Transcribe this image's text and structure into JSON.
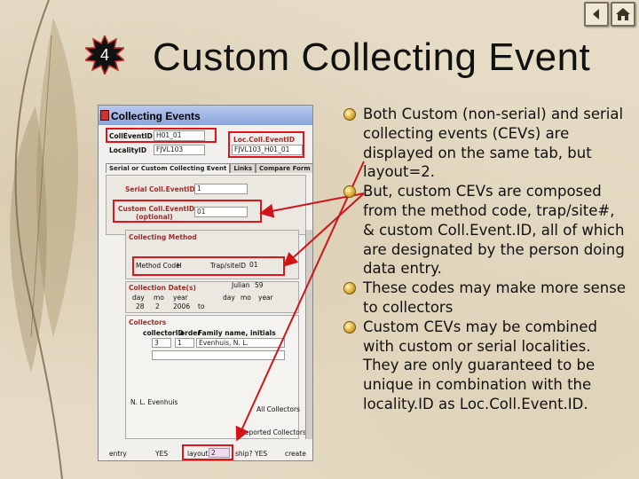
{
  "slide": {
    "number": "4",
    "title": "Custom Collecting Event"
  },
  "nav": {
    "back_icon": "back-arrow-icon",
    "home_icon": "home-icon"
  },
  "screenshot": {
    "header_title": "Collecting Events",
    "coll_event_id_label": "CollEventID",
    "coll_event_id_value": "H01_01",
    "locality_id_label": "LocalityID",
    "locality_id_value": "FJVL103",
    "loc_coll_event_id_label": "Loc.Coll.EventID",
    "loc_coll_event_id_value": "FJVL103_H01_01",
    "tabs": [
      "Serial or Custom Collecting Event",
      "Links",
      "Compare Form"
    ],
    "serial_label": "Serial Coll.EventID",
    "serial_value": "1",
    "custom_label_1": "Custom Coll.EventID",
    "custom_label_2": "(optional)",
    "custom_value": "01",
    "method_header": "Collecting Method",
    "method_code_label": "Method Code",
    "method_code_value": "H",
    "trap_label": "Trap/siteID",
    "trap_value": "01",
    "dates_header": "Collection Date(s)",
    "julian_label": "Julian",
    "julian_value": "59",
    "day_label": "day",
    "mo_label": "mo",
    "year_label": "year",
    "day_value": "28",
    "mo_value": "2",
    "year_value": "2006",
    "to_label": "to",
    "collectors_header": "Collectors",
    "col_collector_id": "collectorID",
    "col_order": "order",
    "col_family": "Family name, initials",
    "collector_row_id": "3",
    "collector_row_order": "1",
    "collector_row_name": "Evenhuis, N. L.",
    "collector_summary": "N. L. Evenhuis",
    "all_collectors": "All Collectors",
    "reported_collectors": "Reported Collectors",
    "footer_entry": "entry",
    "footer_yes": "YES",
    "footer_layout": "layout",
    "footer_layout_value": "2",
    "footer_ship": "ship?",
    "footer_yes2": "YES",
    "footer_create": "create"
  },
  "bullets": [
    "Both Custom (non-serial) and serial collecting events (CEVs) are displayed on the same tab, but layout=2.",
    "But, custom CEVs are composed from the method code, trap/site#, & custom Coll.Event.ID, all of which are designated by the person doing data entry.",
    "These codes may make more sense to collectors",
    "Custom CEVs may be combined with custom or serial localities. They are only guaranteed to be unique in combination with the locality.ID as Loc.Coll.Event.ID."
  ],
  "colors": {
    "background": "#e6dcc6",
    "highlight_box": "#e0141a",
    "arrow": "#d01419",
    "bullet_gold": "#d9a930",
    "badge": "#111111"
  }
}
